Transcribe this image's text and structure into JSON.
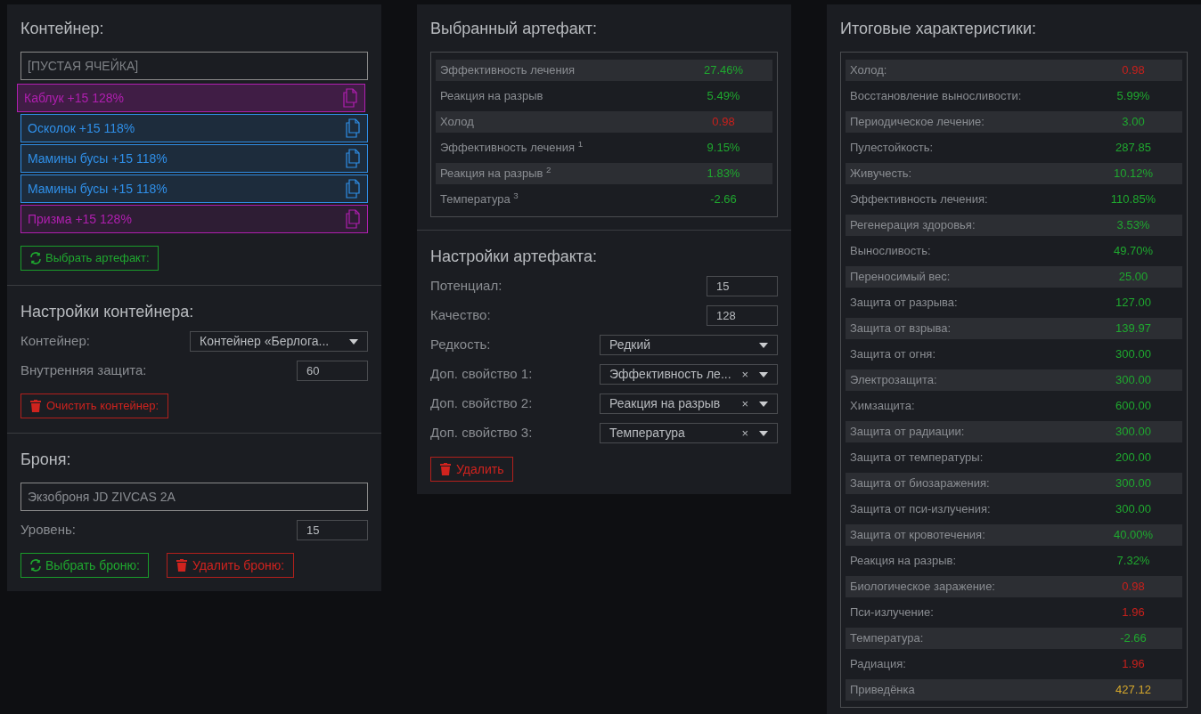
{
  "container": {
    "title": "Контейнер:",
    "slots": [
      {
        "kind": "empty",
        "label": "[ПУСТАЯ ЯЧЕЙКА]",
        "selected": false
      },
      {
        "kind": "artifact",
        "label": "Каблук +15 128%",
        "color": "#b01fb0",
        "selected": true
      },
      {
        "kind": "artifact",
        "label": "Осколок +15 118%",
        "color": "#2f8fe8",
        "selected": false
      },
      {
        "kind": "artifact",
        "label": "Мамины бусы +15 118%",
        "color": "#2f8fe8",
        "selected": false
      },
      {
        "kind": "artifact",
        "label": "Мамины бусы +15 118%",
        "color": "#2f8fe8",
        "selected": false
      },
      {
        "kind": "artifact",
        "label": "Призма +15 128%",
        "color": "#b01fb0",
        "selected": false
      }
    ],
    "select_button": "Выбрать артефакт:"
  },
  "container_settings": {
    "title": "Настройки контейнера:",
    "fields": [
      {
        "kind": "select",
        "label": "Контейнер:",
        "value": "Контейнер «Берлога..."
      },
      {
        "kind": "number",
        "label": "Внутренняя защита:",
        "value": "60"
      }
    ],
    "clear_button": "Очистить контейнер:"
  },
  "armor": {
    "title": "Броня:",
    "name": "Экзоброня JD ZIVCAS 2A",
    "fields": [
      {
        "kind": "number",
        "label": "Уровень:",
        "value": "15"
      }
    ],
    "buttons": [
      {
        "kind": "select",
        "label": "Выбрать броню:"
      },
      {
        "kind": "delete",
        "label": "Удалить броню:"
      }
    ]
  },
  "selected_artifact": {
    "title": "Выбранный артефакт:",
    "stats": [
      {
        "label": "Эффективность лечения",
        "value": "27.46%",
        "color": "#1fa82f"
      },
      {
        "label": "Реакция на разрыв",
        "value": "5.49%",
        "color": "#1fa82f"
      },
      {
        "label": "Холод",
        "value": "0.98",
        "color": "#c8201c"
      },
      {
        "label": "Эффективность лечения $^{1}$",
        "value": "9.15%",
        "color": "#1fa82f"
      },
      {
        "label": "Реакция на разрыв $^{2}$",
        "value": "1.83%",
        "color": "#1fa82f"
      },
      {
        "label": "Температура $^{3}$",
        "value": "-2.66",
        "color": "#1fa82f"
      }
    ]
  },
  "artifact_settings": {
    "title": "Настройки артефакта:",
    "fields": [
      {
        "kind": "number",
        "label": "Потенциал:",
        "value": "15"
      },
      {
        "kind": "number",
        "label": "Качество:",
        "value": "128"
      },
      {
        "kind": "select",
        "label": "Редкость:",
        "value": "Редкий"
      },
      {
        "kind": "select",
        "label": "Доп. свойство 1:",
        "value": "Эффективность ле...",
        "clear": "×"
      },
      {
        "kind": "select",
        "label": "Доп. свойство 2:",
        "value": "Реакция на разрыв",
        "clear": "×"
      },
      {
        "kind": "select",
        "label": "Доп. свойство 3:",
        "value": "Температура",
        "clear": "×"
      }
    ],
    "delete_button": "Удалить"
  },
  "totals": {
    "title": "Итоговые характеристики:",
    "stats": [
      {
        "label": "Холод:",
        "value": "0.98",
        "color": "#c8201c"
      },
      {
        "label": "Восстановление выносливости:",
        "value": "5.99%",
        "color": "#1fa82f"
      },
      {
        "label": "Периодическое лечение:",
        "value": "3.00",
        "color": "#1fa82f"
      },
      {
        "label": "Пулестойкость:",
        "value": "287.85",
        "color": "#1fa82f"
      },
      {
        "label": "Живучесть:",
        "value": "10.12%",
        "color": "#1fa82f"
      },
      {
        "label": "Эффективность лечения:",
        "value": "110.85%",
        "color": "#1fa82f"
      },
      {
        "label": "Регенерация здоровья:",
        "value": "3.53%",
        "color": "#1fa82f"
      },
      {
        "label": "Выносливость:",
        "value": "49.70%",
        "color": "#1fa82f"
      },
      {
        "label": "Переносимый вес:",
        "value": "25.00",
        "color": "#1fa82f"
      },
      {
        "label": "Защита от разрыва:",
        "value": "127.00",
        "color": "#1fa82f"
      },
      {
        "label": "Защита от взрыва:",
        "value": "139.97",
        "color": "#1fa82f"
      },
      {
        "label": "Защита от огня:",
        "value": "300.00",
        "color": "#1fa82f"
      },
      {
        "label": "Электрозащита:",
        "value": "300.00",
        "color": "#1fa82f"
      },
      {
        "label": "Химзащита:",
        "value": "600.00",
        "color": "#1fa82f"
      },
      {
        "label": "Защита от радиации:",
        "value": "300.00",
        "color": "#1fa82f"
      },
      {
        "label": "Защита от температуры:",
        "value": "200.00",
        "color": "#1fa82f"
      },
      {
        "label": "Защита от биозаражения:",
        "value": "300.00",
        "color": "#1fa82f"
      },
      {
        "label": "Защита от пси-излучения:",
        "value": "300.00",
        "color": "#1fa82f"
      },
      {
        "label": "Защита от кровотечения:",
        "value": "40.00%",
        "color": "#1fa82f"
      },
      {
        "label": "Реакция на разрыв:",
        "value": "7.32%",
        "color": "#1fa82f"
      },
      {
        "label": "Биологическое заражение:",
        "value": "0.98",
        "color": "#c8201c"
      },
      {
        "label": "Пси-излучение:",
        "value": "1.96",
        "color": "#c8201c"
      },
      {
        "label": "Температура:",
        "value": "-2.66",
        "color": "#1fa82f"
      },
      {
        "label": "Радиация:",
        "value": "1.96",
        "color": "#c8201c"
      },
      {
        "label": "Приведёнка",
        "value": "427.12",
        "color": "#d4a72c"
      }
    ]
  }
}
